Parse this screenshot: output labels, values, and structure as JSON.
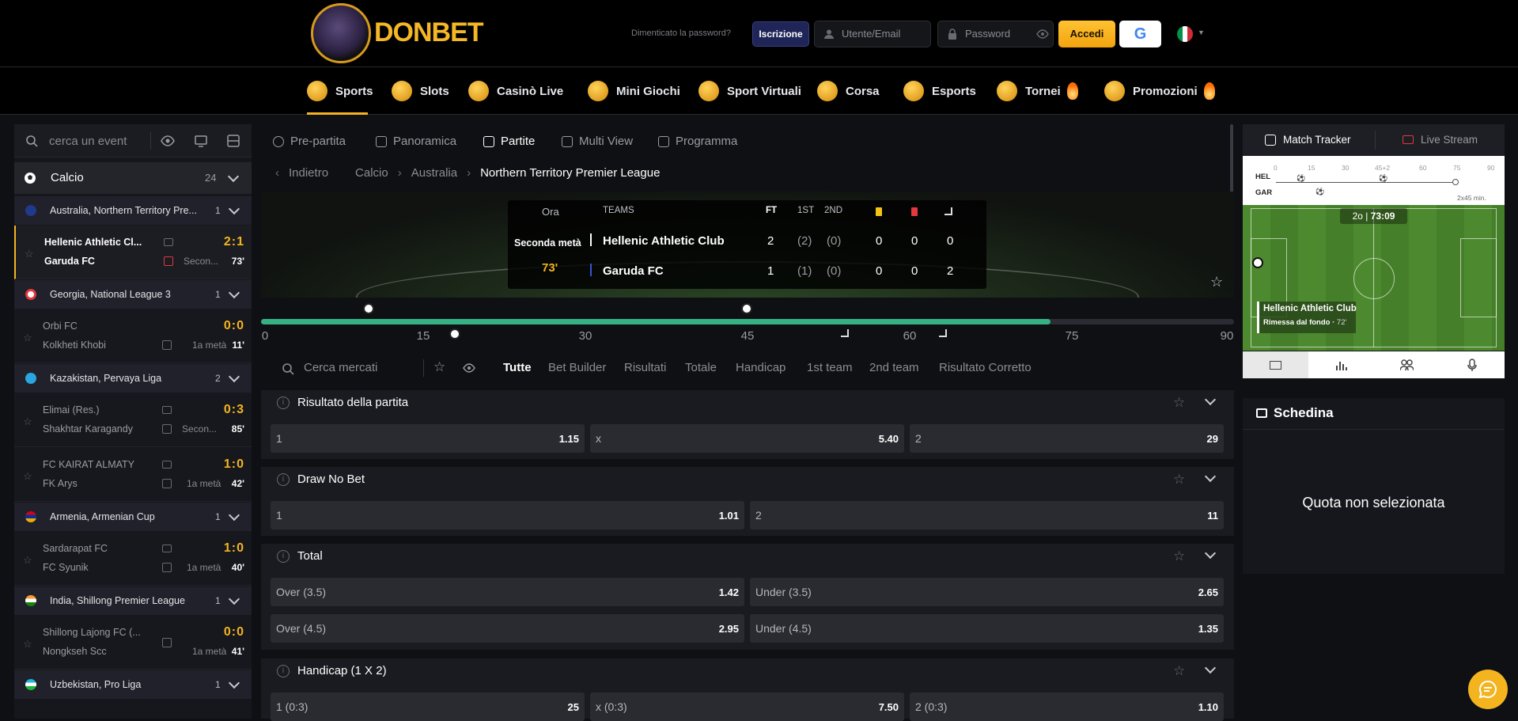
{
  "header": {
    "logo_text": "DONBET",
    "forgot": "Dimenticato la password?",
    "register": "Iscrizione",
    "user_placeholder": "Utente/Email",
    "pass_placeholder": "Password",
    "login": "Accedi",
    "google": "G",
    "flag_colors": [
      "#009246",
      "#ffffff",
      "#ce2b37"
    ]
  },
  "nav": [
    {
      "label": "Sports",
      "icon": "basketball-icon"
    },
    {
      "label": "Slots",
      "icon": "slots-icon"
    },
    {
      "label": "Casinò Live",
      "icon": "spade-icon"
    },
    {
      "label": "Mini Giochi",
      "icon": "rocket-icon"
    },
    {
      "label": "Sport Virtuali",
      "icon": "gamepad-icon"
    },
    {
      "label": "Corsa",
      "icon": "horse-icon"
    },
    {
      "label": "Esports",
      "icon": "esports-icon"
    },
    {
      "label": "Tornei",
      "icon": "trophy-icon"
    },
    {
      "label": "Promozioni",
      "icon": "gift-icon"
    }
  ],
  "sidebar": {
    "search_placeholder": "cerca un event",
    "sport": {
      "label": "Calcio",
      "count": "24"
    },
    "leagues": [
      {
        "name": "Australia, Northern Territory Pre...",
        "count": "1",
        "flag": "#1f3a8a"
      },
      {
        "name": "Georgia, National League 3",
        "count": "1",
        "flag": "#e0393e"
      },
      {
        "name": "Kazakistan, Pervaya Liga",
        "count": "2",
        "flag": "#2aa5e0"
      },
      {
        "name": "Armenia, Armenian Cup",
        "count": "1",
        "flag": "#d97a1e"
      },
      {
        "name": "India, Shillong Premier League",
        "count": "1",
        "flag": "#f49c2a"
      },
      {
        "name": "Uzbekistan, Pro Liga",
        "count": "1",
        "flag": "#2e86c1"
      }
    ],
    "matches": [
      {
        "t1": "Hellenic Athletic Cl...",
        "t2": "Garuda FC",
        "score": "2:1",
        "period": "Secon...",
        "min": "73'"
      },
      {
        "t1": "Orbi FC",
        "t2": "Kolkheti Khobi",
        "score": "0:0",
        "period": "1a metà",
        "min": "11'"
      },
      {
        "t1": "Elimai (Res.)",
        "t2": "Shakhtar Karagandy",
        "score": "0:3",
        "period": "Secon...",
        "min": "85'"
      },
      {
        "t1": "FC KAIRAT ALMATY",
        "t2": "FK Arys",
        "score": "1:0",
        "period": "1a metà",
        "min": "42'"
      },
      {
        "t1": "Sardarapat FC",
        "t2": "FC Syunik",
        "score": "1:0",
        "period": "1a metà",
        "min": "40'"
      },
      {
        "t1": "Shillong Lajong FC (...",
        "t2": "Nongkseh Scc",
        "score": "0:0",
        "period": "1a metà",
        "min": "41'"
      }
    ]
  },
  "center_tabs": [
    "Pre-partita",
    "Panoramica",
    "Partite",
    "Multi View",
    "Programma"
  ],
  "breadcrumb": {
    "back": "Indietro",
    "items": [
      "Calcio",
      "Australia"
    ],
    "current": "Northern Territory Premier League"
  },
  "scoreboard": {
    "headers": {
      "time": "Ora",
      "teams": "TEAMS",
      "ft": "FT",
      "first": "1ST",
      "second": "2ND"
    },
    "period": "Seconda metà",
    "minute": "73'",
    "home": {
      "name": "Hellenic Athletic Club",
      "ft": "2",
      "h1": "(2)",
      "h2": "(0)",
      "yellow": "0",
      "red": "0",
      "corner": "0"
    },
    "away": {
      "name": "Garuda FC",
      "ft": "1",
      "h1": "(1)",
      "h2": "(0)",
      "yellow": "0",
      "red": "0",
      "corner": "2"
    }
  },
  "timeline": {
    "ticks": [
      "0",
      "15",
      "30",
      "45",
      "60",
      "75",
      "90"
    ],
    "progress": 0.811
  },
  "market_filter": {
    "placeholder": "Cerca mercati",
    "tabs": [
      "Tutte",
      "Bet Builder",
      "Risultati",
      "Totale",
      "Handicap",
      "1st team",
      "2nd team",
      "Risultato Corretto"
    ]
  },
  "markets": [
    {
      "title": "Risultato della partita",
      "rows": [
        [
          {
            "l": "1",
            "v": "1.15"
          },
          {
            "l": "x",
            "v": "5.40"
          },
          {
            "l": "2",
            "v": "29"
          }
        ]
      ]
    },
    {
      "title": "Draw No Bet",
      "rows": [
        [
          {
            "l": "1",
            "v": "1.01"
          },
          {
            "l": "2",
            "v": "11"
          }
        ]
      ]
    },
    {
      "title": "Total",
      "rows": [
        [
          {
            "l": "Over (3.5)",
            "v": "1.42"
          },
          {
            "l": "Under (3.5)",
            "v": "2.65"
          }
        ],
        [
          {
            "l": "Over (4.5)",
            "v": "2.95"
          },
          {
            "l": "Under (4.5)",
            "v": "1.35"
          }
        ]
      ]
    },
    {
      "title": "Handicap (1 X 2)",
      "rows": [
        [
          {
            "l": "1 (0:3)",
            "v": "25"
          },
          {
            "l": "x (0:3)",
            "v": "7.50"
          },
          {
            "l": "2 (0:3)",
            "v": "1.10"
          }
        ]
      ]
    }
  ],
  "tracker": {
    "tab_match": "Match Tracker",
    "tab_stream": "Live Stream",
    "graph_ticks": [
      "0",
      "15",
      "30",
      "45+2",
      "60",
      "75",
      "90"
    ],
    "home_abbr": "HEL",
    "away_abbr": "GAR",
    "extra": "2x45 min.",
    "clock_period": "2o",
    "clock": "73:09",
    "event_team": "Hellenic Athletic Club",
    "event_text": "Rimessa dal fondo",
    "event_min": "72'"
  },
  "betslip": {
    "title": "Schedina",
    "empty": "Quota non selezionata"
  }
}
